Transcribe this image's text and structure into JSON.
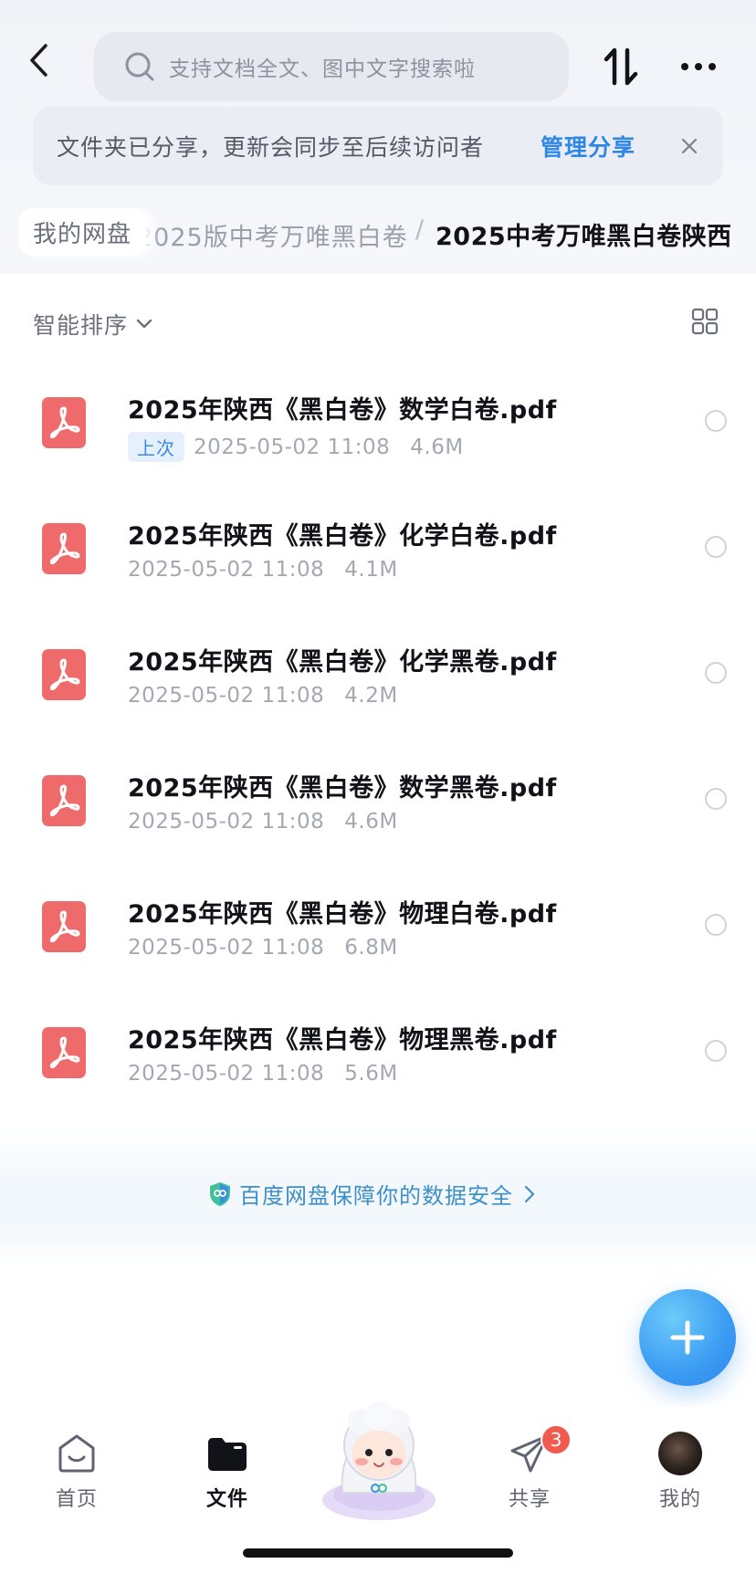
{
  "header": {
    "search_placeholder": "支持文档全文、图中文字搜索啦"
  },
  "share_banner": {
    "message": "文件夹已分享，更新会同步至后续访问者",
    "manage_label": "管理分享"
  },
  "breadcrumb": {
    "root": "我的网盘",
    "middle": "2025版中考万唯黑白卷",
    "separator": "/",
    "current": "2025中考万唯黑白卷陕西"
  },
  "toolbar": {
    "sort_label": "智能排序"
  },
  "files": [
    {
      "name": "2025年陕西《黑白卷》数学白卷.pdf",
      "tag": "上次",
      "date": "2025-05-02 11:08",
      "size": "4.6M"
    },
    {
      "name": "2025年陕西《黑白卷》化学白卷.pdf",
      "tag": "",
      "date": "2025-05-02 11:08",
      "size": "4.1M"
    },
    {
      "name": "2025年陕西《黑白卷》化学黑卷.pdf",
      "tag": "",
      "date": "2025-05-02 11:08",
      "size": "4.2M"
    },
    {
      "name": "2025年陕西《黑白卷》数学黑卷.pdf",
      "tag": "",
      "date": "2025-05-02 11:08",
      "size": "4.6M"
    },
    {
      "name": "2025年陕西《黑白卷》物理白卷.pdf",
      "tag": "",
      "date": "2025-05-02 11:08",
      "size": "6.8M"
    },
    {
      "name": "2025年陕西《黑白卷》物理黑卷.pdf",
      "tag": "",
      "date": "2025-05-02 11:08",
      "size": "5.6M"
    }
  ],
  "footer": {
    "safety_text": "百度网盘保障你的数据安全"
  },
  "tabbar": {
    "home": "首页",
    "files": "文件",
    "share": "共享",
    "share_badge": "3",
    "mine": "我的"
  },
  "colors": {
    "accent": "#2f87e8",
    "pdf_red": "#ef6b6b",
    "badge_red": "#f05a4f"
  }
}
